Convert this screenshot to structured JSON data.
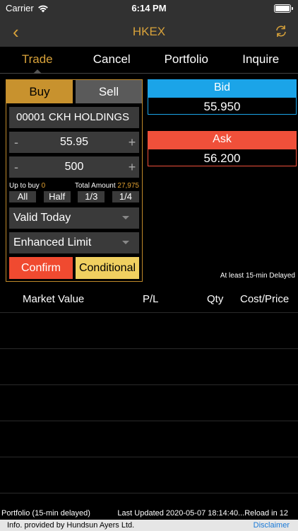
{
  "status": {
    "carrier": "Carrier",
    "time": "6:14 PM"
  },
  "nav": {
    "back": "‹",
    "title": "HKEX"
  },
  "tabs": [
    "Trade",
    "Cancel",
    "Portfolio",
    "Inquire"
  ],
  "order": {
    "buy": "Buy",
    "sell": "Sell",
    "stock": "00001 CKH HOLDINGS",
    "price": "55.95",
    "quantity": "500",
    "minus": "-",
    "plus": "+",
    "upto_label": "Up to buy",
    "upto_value": "0",
    "total_label": "Total Amount",
    "total_value": "27,975",
    "fractions": [
      "All",
      "Half",
      "1/3",
      "1/4"
    ],
    "validity": "Valid Today",
    "order_type": "Enhanced Limit",
    "confirm": "Confirm",
    "conditional": "Conditional"
  },
  "quote": {
    "bid_label": "Bid",
    "bid_value": "55.950",
    "ask_label": "Ask",
    "ask_value": "56.200"
  },
  "delayed_note": "At least 15-min Delayed",
  "portfolio": {
    "col_market_value": "Market Value",
    "col_pl": "P/L",
    "col_qty": "Qty",
    "col_cost": "Cost/Price"
  },
  "footer": {
    "portfolio_note": "Portfolio (15-min delayed)",
    "last_updated": "Last Updated 2020-05-07 18:14:40...Reload in 12",
    "provider": "Info. provided by Hundsun Ayers Ltd.",
    "disclaimer": "Disclaimer"
  },
  "colors": {
    "accent": "#d8a23a",
    "bid": "#1ba4e8",
    "ask": "#f0503a",
    "confirm": "#f04a30",
    "conditional": "#f0d060"
  }
}
